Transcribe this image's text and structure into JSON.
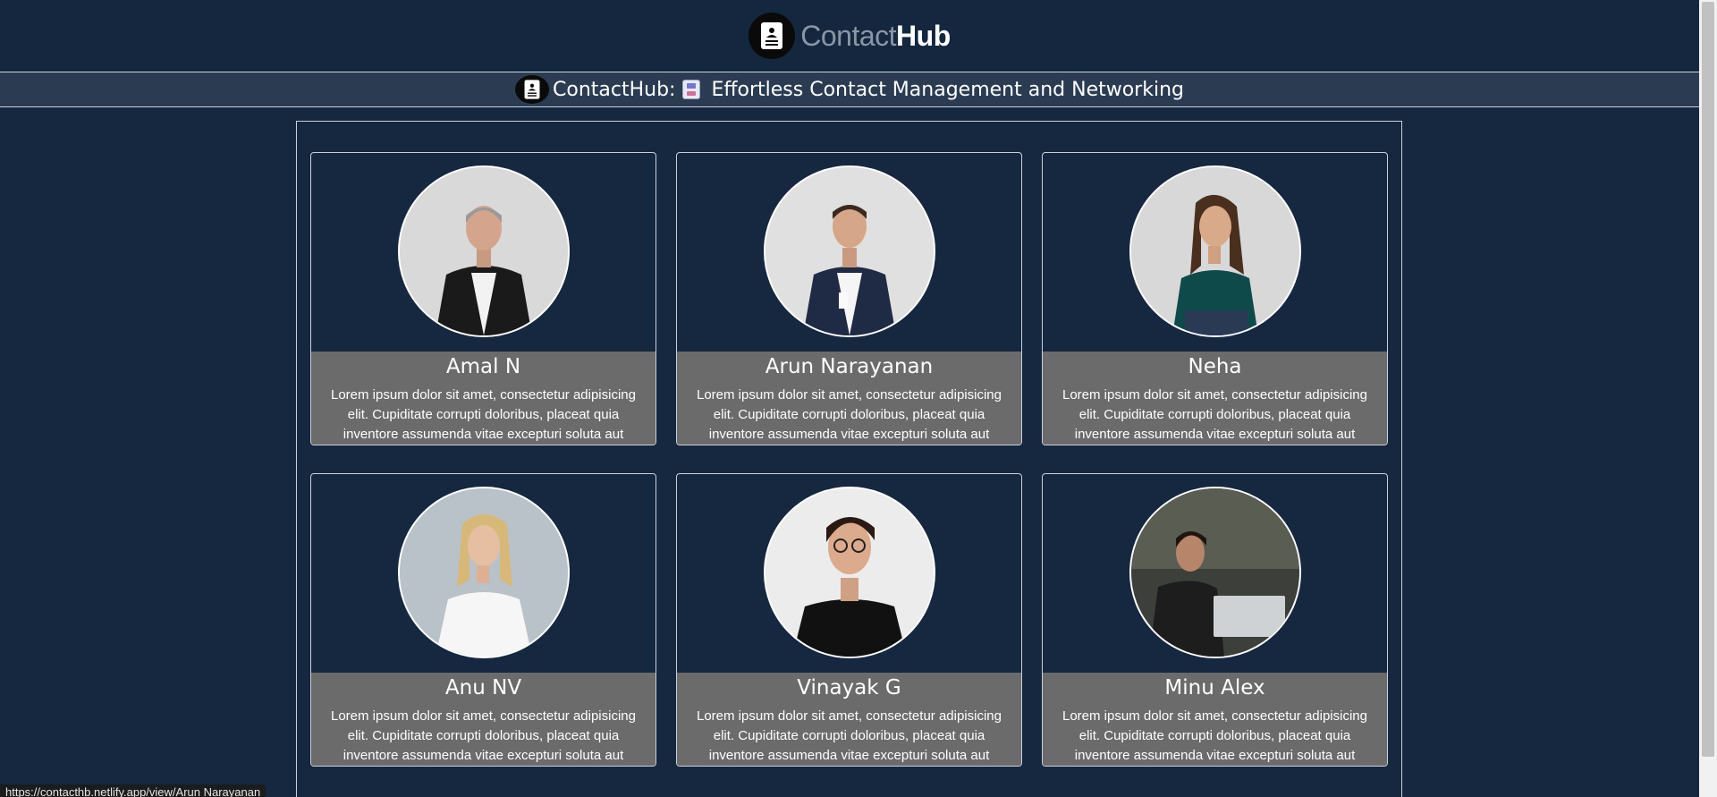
{
  "header": {
    "brand_part1": "Contact",
    "brand_part2": "Hub",
    "logo_icon": "contact-card-icon"
  },
  "tagline": {
    "text1": "ContactHub:",
    "text2": "Effortless Contact Management and Networking",
    "icon": "card-index-icon"
  },
  "contacts": [
    {
      "name": "Amal N",
      "description": "Lorem ipsum dolor sit amet, consectetur adipisicing elit. Cupiditate corrupti doloribus, placeat quia inventore assumenda vitae excepturi soluta aut veritatis."
    },
    {
      "name": "Arun Narayanan",
      "description": "Lorem ipsum dolor sit amet, consectetur adipisicing elit. Cupiditate corrupti doloribus, placeat quia inventore assumenda vitae excepturi soluta aut veritatis."
    },
    {
      "name": "Neha",
      "description": "Lorem ipsum dolor sit amet, consectetur adipisicing elit. Cupiditate corrupti doloribus, placeat quia inventore assumenda vitae excepturi soluta aut veritatis."
    },
    {
      "name": "Anu NV",
      "description": "Lorem ipsum dolor sit amet, consectetur adipisicing elit. Cupiditate corrupti doloribus, placeat quia inventore assumenda vitae excepturi soluta aut veritatis."
    },
    {
      "name": "Vinayak G",
      "description": "Lorem ipsum dolor sit amet, consectetur adipisicing elit. Cupiditate corrupti doloribus, placeat quia inventore assumenda vitae excepturi soluta aut veritatis."
    },
    {
      "name": "Minu Alex",
      "description": "Lorem ipsum dolor sit amet, consectetur adipisicing elit. Cupiditate corrupti doloribus, placeat quia inventore assumenda vitae excepturi soluta aut veritatis."
    }
  ],
  "status_url": "https://contacthb.netlify.app/view/Arun Narayanan",
  "colors": {
    "background": "#162740",
    "band": "#2b3c52",
    "card_info": "#6b6b6b"
  }
}
